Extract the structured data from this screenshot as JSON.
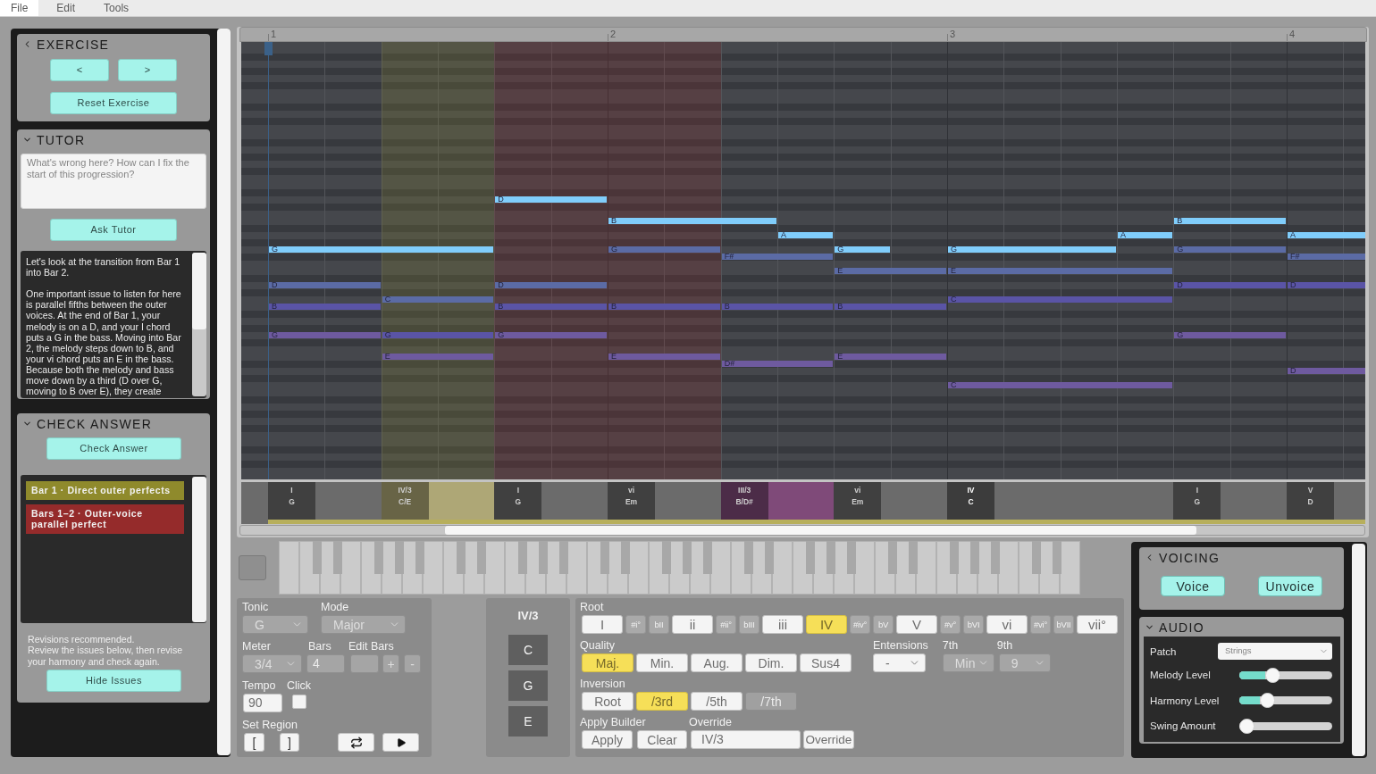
{
  "menu": [
    {
      "label": "File",
      "selected": true
    },
    {
      "label": "Edit",
      "selected": false
    },
    {
      "label": "Tools",
      "selected": false
    }
  ],
  "exercise": {
    "title": "EXERCISE",
    "kind": "nav",
    "nav_buttons": [
      "<",
      ">"
    ],
    "reset_button": "Reset Exercise"
  },
  "tutor": {
    "title": "TUTOR",
    "kind": "fold",
    "placeholder": "What's wrong here? How can I fix the start of this progression?",
    "ask_button": "Ask Tutor",
    "response": [
      "Let's look at the transition from Bar 1 into Bar 2.",
      "One important issue to listen for here is parallel fifths between the outer voices. At the end of Bar 1, your melody is on a D, and your I chord puts a G in the bass. Moving into Bar 2, the melody steps down to B, and your vi chord puts an E in the bass. Because both the melody and bass move down by a third (D over G, moving to B over E), they create"
    ]
  },
  "check_answer": {
    "title": "CHECK ANSWER",
    "kind": "fold",
    "check_button": "Check Answer",
    "issues": [
      {
        "label": "Bar 1 · Direct outer perfects",
        "color": "#8f8a2c"
      },
      {
        "label": "Bars 1–2 · Outer-voice parallel perfect",
        "color": "#952b2b"
      }
    ],
    "status": "Revisions recommended.",
    "advice": "Review the issues below, then revise your harmony and check again.",
    "hide_button": "Hide Issues"
  },
  "piano_roll": {
    "bars": [
      "1",
      "2",
      "3",
      "4"
    ],
    "voices": [
      {
        "color": "#80cdfb",
        "notes": [
          "G",
          "D",
          "B",
          "A",
          "G",
          "G",
          "A",
          "B",
          "A"
        ]
      },
      {
        "color": "#5b6ba5",
        "notes": [
          "D",
          "C",
          "D",
          "G",
          "F#",
          "E",
          "E",
          "G",
          "F#"
        ]
      },
      {
        "color": "#5a54a6",
        "notes": [
          "B",
          "G",
          "B",
          "B",
          "B",
          "B",
          "C",
          "D",
          "D"
        ]
      },
      {
        "color": "#6e5a9f",
        "notes": [
          "G",
          "E",
          "G",
          "E",
          "D#",
          "E",
          "C",
          "G",
          "D"
        ]
      }
    ],
    "chords": [
      {
        "numeral": "I",
        "name": "G",
        "selected": false
      },
      {
        "numeral": "IV/3",
        "name": "C/E",
        "selected": false,
        "color": "#aea776"
      },
      {
        "numeral": "I",
        "name": "G",
        "selected": false
      },
      {
        "numeral": "vi",
        "name": "Em",
        "selected": false
      },
      {
        "numeral": "III/3",
        "name": "B/D#",
        "selected": false,
        "color": "#7f4a79"
      },
      {
        "numeral": "vi",
        "name": "Em",
        "selected": false
      },
      {
        "numeral": "IV",
        "name": "C",
        "selected": true
      },
      {
        "numeral": "I",
        "name": "G",
        "selected": false
      },
      {
        "numeral": "V",
        "name": "D",
        "selected": false
      }
    ]
  },
  "settings": {
    "tonic": {
      "label": "Tonic",
      "value": "G",
      "disabled": true
    },
    "mode": {
      "label": "Mode",
      "value": "Major",
      "disabled": true
    },
    "meter": {
      "label": "Meter",
      "value": "3/4",
      "disabled": true
    },
    "bars": {
      "label": "Bars",
      "value": "4",
      "disabled": true
    },
    "edit_bars": {
      "label": "Edit Bars",
      "buttons": [
        "+",
        "-"
      ],
      "disabled": true
    },
    "tempo": {
      "label": "Tempo",
      "value": "90"
    },
    "click": {
      "label": "Click",
      "checked": false
    },
    "region": {
      "label": "Set Region",
      "buttons": [
        "[",
        "]"
      ]
    }
  },
  "chord_preview": {
    "symbol": "IV/3",
    "notes": [
      "C",
      "G",
      "E"
    ]
  },
  "builder": {
    "root": {
      "label": "Root",
      "options": [
        {
          "label": "I",
          "kind": "diatonic",
          "selected": false
        },
        {
          "label": "#i°",
          "kind": "chromatic",
          "selected": false
        },
        {
          "label": "bII",
          "kind": "chromatic",
          "selected": false
        },
        {
          "label": "ii",
          "kind": "diatonic",
          "selected": false
        },
        {
          "label": "#ii°",
          "kind": "chromatic",
          "selected": false
        },
        {
          "label": "bIII",
          "kind": "chromatic",
          "selected": false
        },
        {
          "label": "iii",
          "kind": "diatonic",
          "selected": false
        },
        {
          "label": "IV",
          "kind": "diatonic",
          "selected": true
        },
        {
          "label": "#iv°",
          "kind": "chromatic",
          "selected": false
        },
        {
          "label": "bV",
          "kind": "chromatic",
          "selected": false
        },
        {
          "label": "V",
          "kind": "diatonic",
          "selected": false
        },
        {
          "label": "#v°",
          "kind": "chromatic",
          "selected": false
        },
        {
          "label": "bVI",
          "kind": "chromatic",
          "selected": false
        },
        {
          "label": "vi",
          "kind": "diatonic",
          "selected": false
        },
        {
          "label": "#vi°",
          "kind": "chromatic",
          "selected": false
        },
        {
          "label": "bVII",
          "kind": "chromatic",
          "selected": false
        },
        {
          "label": "vii°",
          "kind": "diatonic",
          "selected": false
        }
      ]
    },
    "quality": {
      "label": "Quality",
      "options": [
        {
          "label": "Maj.",
          "selected": true
        },
        {
          "label": "Min.",
          "selected": false
        },
        {
          "label": "Aug.",
          "selected": false
        },
        {
          "label": "Dim.",
          "selected": false
        },
        {
          "label": "Sus4",
          "selected": false
        }
      ]
    },
    "extensions": {
      "label": "Entensions",
      "value": "-",
      "disabled": false
    },
    "seventh": {
      "label": "7th",
      "value": "Min",
      "disabled": true
    },
    "ninth": {
      "label": "9th",
      "value": "9",
      "disabled": true
    },
    "inversion": {
      "label": "Inversion",
      "options": [
        {
          "label": "Root",
          "selected": false,
          "disabled": false
        },
        {
          "label": "/3rd",
          "selected": true,
          "disabled": false
        },
        {
          "label": "/5th",
          "selected": false,
          "disabled": false
        },
        {
          "label": "/7th",
          "selected": false,
          "disabled": true
        }
      ]
    },
    "apply": {
      "label": "Apply Builder",
      "buttons": [
        "Apply",
        "Clear"
      ]
    },
    "override": {
      "label": "Override",
      "value": "IV/3",
      "button": "Override"
    }
  },
  "voicing": {
    "title": "VOICING",
    "kind": "nav",
    "buttons": [
      "Voice",
      "Unvoice"
    ]
  },
  "audio": {
    "title": "AUDIO",
    "kind": "fold",
    "patch": {
      "label": "Patch",
      "value": "Strings"
    },
    "sliders": [
      {
        "label": "Melody Level",
        "level": 0.33
      },
      {
        "label": "Harmony Level",
        "level": 0.27
      },
      {
        "label": "Swing Amount",
        "level": 0
      }
    ]
  }
}
